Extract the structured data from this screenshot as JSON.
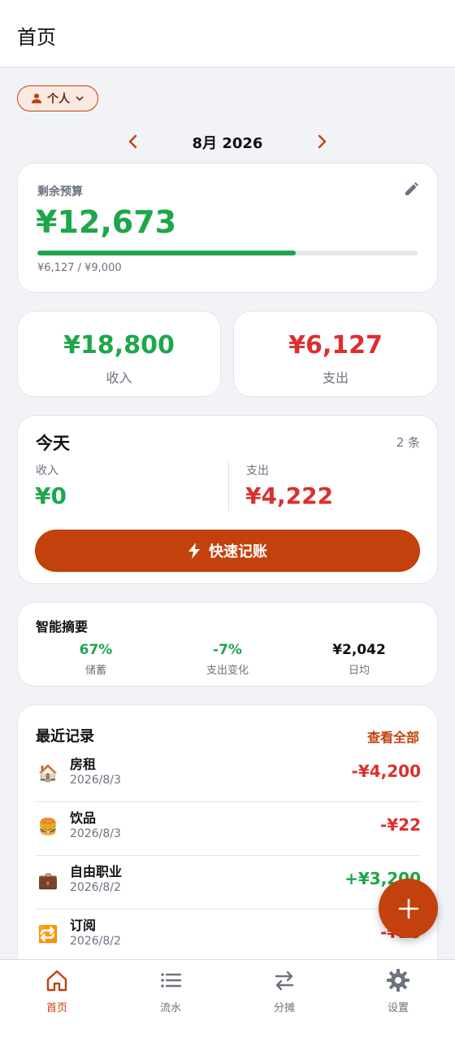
{
  "header": {
    "title": "首页"
  },
  "profile_chip": {
    "label": "个人"
  },
  "month": {
    "label": "8月 2026"
  },
  "budget": {
    "label": "剩余预算",
    "amount": "¥12,673",
    "spent_of_total": "¥6,127 / ¥9,000",
    "progress_fraction": 0.68
  },
  "totals": {
    "income_value": "¥18,800",
    "income_label": "收入",
    "expense_value": "¥6,127",
    "expense_label": "支出"
  },
  "today": {
    "title": "今天",
    "count": "2 条",
    "income_label": "收入",
    "income_value": "¥0",
    "expense_label": "支出",
    "expense_value": "¥4,222",
    "quick_button": "快速记账"
  },
  "summary": {
    "title": "智能摘要",
    "items": [
      {
        "value": "67%",
        "label": "储蓄"
      },
      {
        "value": "-7%",
        "label": "支出变化"
      },
      {
        "value": "¥2,042",
        "label": "日均"
      }
    ]
  },
  "recent": {
    "title": "最近记录",
    "view_all": "查看全部",
    "records": [
      {
        "icon": "house-icon",
        "emoji": "🏠",
        "name": "房租",
        "date": "2026/8/3",
        "amount": "-¥4,200",
        "type": "expense"
      },
      {
        "icon": "burger-icon",
        "emoji": "🍔",
        "name": "饮品",
        "date": "2026/8/3",
        "amount": "-¥22",
        "type": "expense"
      },
      {
        "icon": "briefcase-icon",
        "emoji": "💼",
        "name": "自由职业",
        "date": "2026/8/2",
        "amount": "+¥3,200",
        "type": "income"
      },
      {
        "icon": "repeat-icon",
        "emoji": "🔁",
        "name": "订阅",
        "date": "2026/8/2",
        "amount": "-¥25",
        "type": "expense"
      }
    ]
  },
  "bottom_nav": {
    "items": [
      {
        "label": "首页",
        "icon": "home-icon",
        "active": true
      },
      {
        "label": "流水",
        "icon": "list-icon",
        "active": false
      },
      {
        "label": "分摊",
        "icon": "swap-arrows-icon",
        "active": false
      },
      {
        "label": "设置",
        "icon": "gear-icon",
        "active": false
      }
    ]
  },
  "colors": {
    "accent": "#c2410c",
    "income": "#1fa64a",
    "expense": "#dc2f2f"
  }
}
